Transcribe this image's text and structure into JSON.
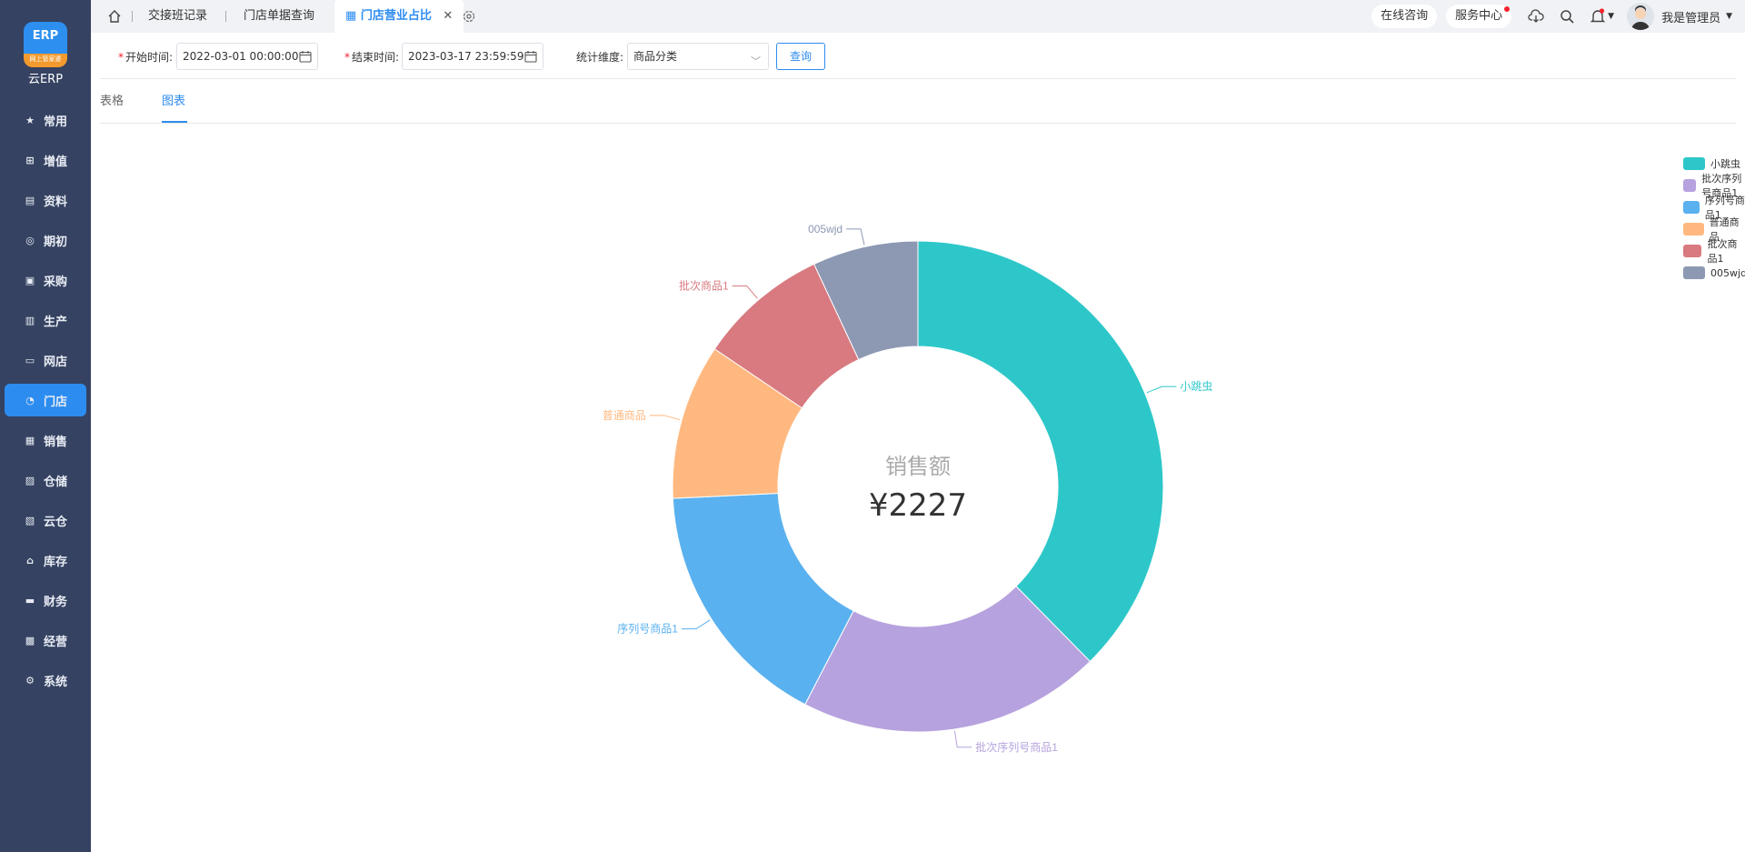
{
  "brand": {
    "logo_text": "ERP",
    "logo_sub": "网上管家婆",
    "name": "云ERP"
  },
  "sidebar": {
    "items": [
      {
        "label": "常用",
        "icon": "star-icon"
      },
      {
        "label": "增值",
        "icon": "plus-square-icon"
      },
      {
        "label": "资料",
        "icon": "document-icon"
      },
      {
        "label": "期初",
        "icon": "target-icon"
      },
      {
        "label": "采购",
        "icon": "purchase-icon"
      },
      {
        "label": "生产",
        "icon": "production-icon"
      },
      {
        "label": "网店",
        "icon": "shop-icon"
      },
      {
        "label": "门店",
        "icon": "pie-icon",
        "active": true
      },
      {
        "label": "销售",
        "icon": "bar-chart-icon"
      },
      {
        "label": "仓储",
        "icon": "warehouse-icon"
      },
      {
        "label": "云仓",
        "icon": "cloud-warehouse-icon"
      },
      {
        "label": "库存",
        "icon": "home-stock-icon"
      },
      {
        "label": "财务",
        "icon": "finance-icon"
      },
      {
        "label": "经营",
        "icon": "business-icon"
      },
      {
        "label": "系统",
        "icon": "system-gear-icon"
      }
    ]
  },
  "tabs": {
    "t1": "交接班记录",
    "t2": "门店单据查询",
    "t3": "门店营业占比",
    "close": "✕"
  },
  "topright": {
    "consult": "在线咨询",
    "service": "服务中心",
    "user": "我是管理员"
  },
  "filter": {
    "start_label": "开始时间:",
    "start_value": "2022-03-01 00:00:00",
    "end_label": "结束时间:",
    "end_value": "2023-03-17 23:59:59",
    "dim_label": "统计维度:",
    "dim_value": "商品分类",
    "query": "查询",
    "required_mark": "*"
  },
  "view_tabs": {
    "table": "表格",
    "chart": "图表"
  },
  "colors": {
    "accent": "#2d8cf0",
    "sidebar": "#354261"
  },
  "chart_data": {
    "type": "pie",
    "center_title": "销售额",
    "center_value": "¥2227",
    "series": [
      {
        "name": "小跳虫",
        "value": 838,
        "color": "#2ec7c9"
      },
      {
        "name": "批次序列号商品1",
        "value": 445,
        "color": "#b6a2de"
      },
      {
        "name": "序列号商品1",
        "value": 370,
        "color": "#5ab1ef"
      },
      {
        "name": "普通商品",
        "value": 228,
        "color": "#ffb980"
      },
      {
        "name": "批次商品1",
        "value": 191,
        "color": "#d87a80"
      },
      {
        "name": "005wjd",
        "value": 155,
        "color": "#8d98b3"
      }
    ],
    "legend_position": "top-right"
  }
}
